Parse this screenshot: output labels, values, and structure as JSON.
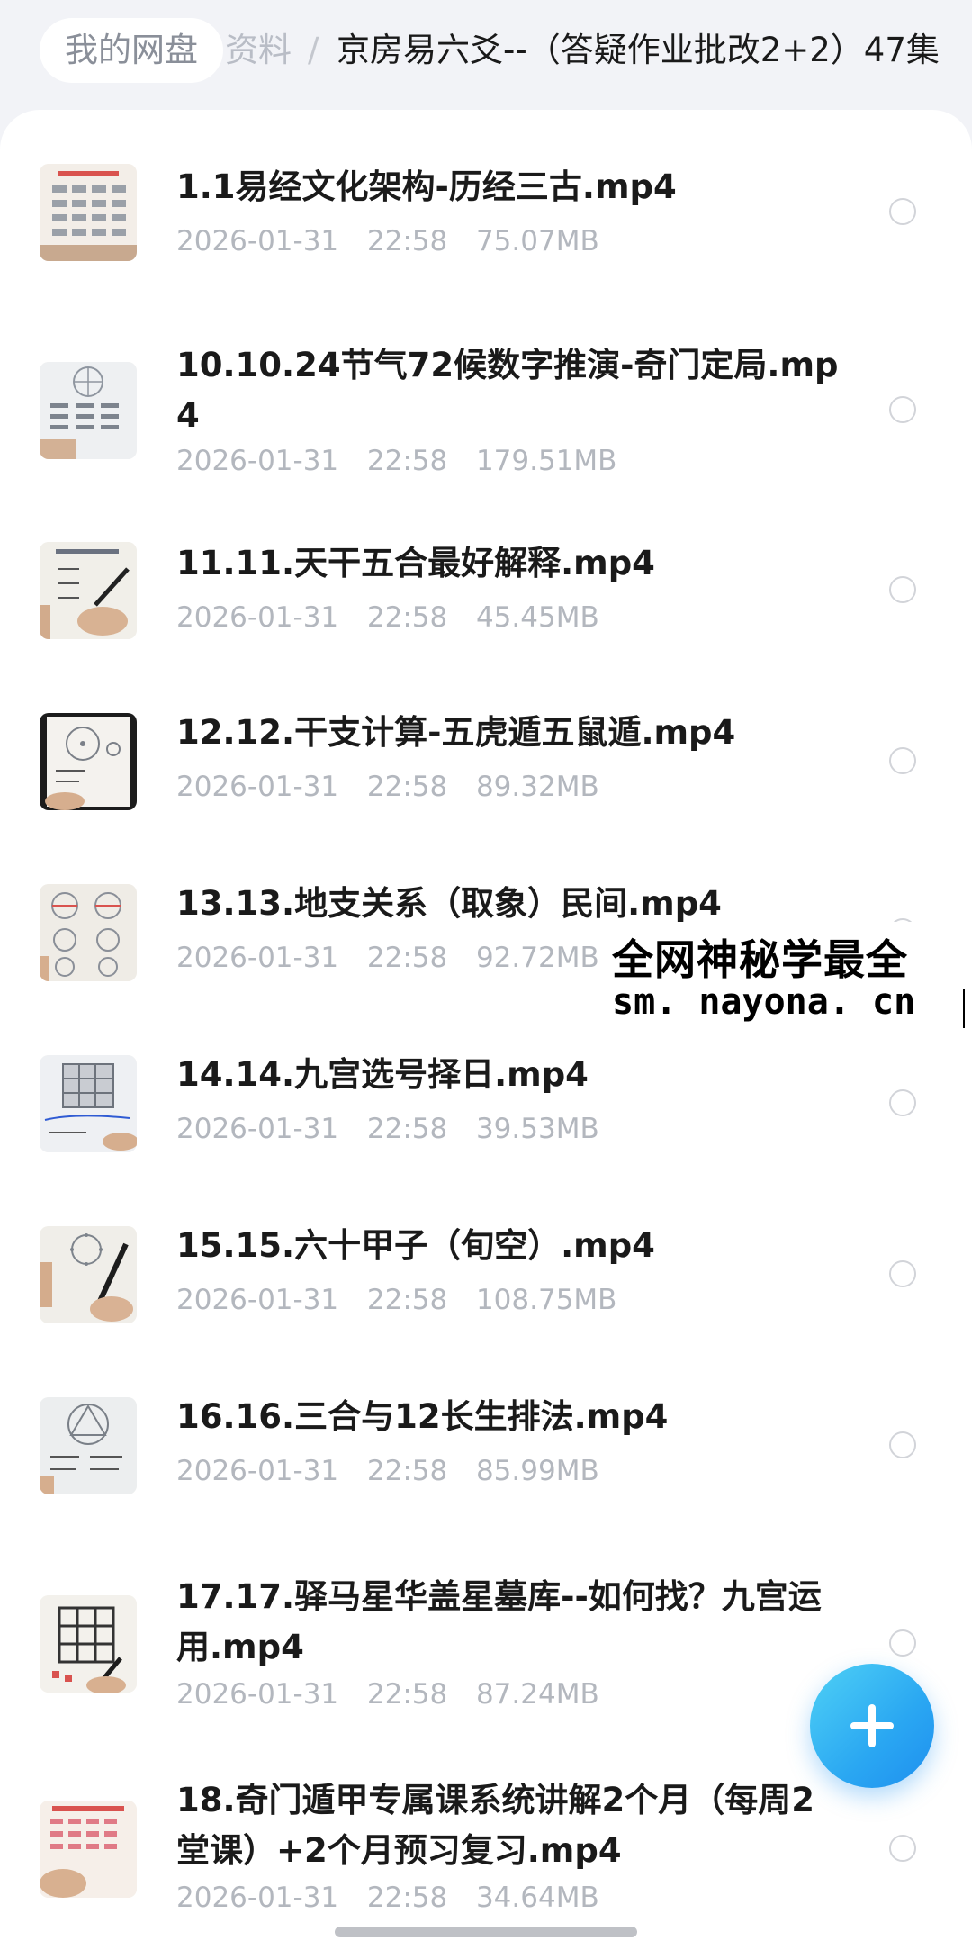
{
  "breadcrumb": {
    "root": "我的网盘",
    "middle": "资料",
    "separator": "/",
    "current": "京房易六爻--（答疑作业批改2+2）47集"
  },
  "files": [
    {
      "name": "1.1易经文化架构-历经三古.mp4",
      "date": "2026-01-31",
      "time": "22:58",
      "size": "75.07MB",
      "thumb_icon": "video-thumbnail-chart-icon"
    },
    {
      "name": "10.10.24节气72候数字推演-奇门定局.mp4",
      "date": "2026-01-31",
      "time": "22:58",
      "size": "179.51MB",
      "thumb_icon": "video-thumbnail-chart-icon"
    },
    {
      "name": "11.11.天干五合最好解释.mp4",
      "date": "2026-01-31",
      "time": "22:58",
      "size": "45.45MB",
      "thumb_icon": "video-thumbnail-handwriting-icon"
    },
    {
      "name": "12.12.干支计算-五虎遁五鼠遁.mp4",
      "date": "2026-01-31",
      "time": "22:58",
      "size": "89.32MB",
      "thumb_icon": "video-thumbnail-wheel-icon"
    },
    {
      "name": "13.13.地支关系（取象）民间.mp4",
      "date": "2026-01-31",
      "time": "22:58",
      "size": "92.72MB",
      "thumb_icon": "video-thumbnail-wheel-icon"
    },
    {
      "name": "14.14.九宫选号择日.mp4",
      "date": "2026-01-31",
      "time": "22:58",
      "size": "39.53MB",
      "thumb_icon": "video-thumbnail-grid-icon"
    },
    {
      "name": "15.15.六十甲子（旬空）.mp4",
      "date": "2026-01-31",
      "time": "22:58",
      "size": "108.75MB",
      "thumb_icon": "video-thumbnail-wheel-icon"
    },
    {
      "name": "16.16.三合与12长生排法.mp4",
      "date": "2026-01-31",
      "time": "22:58",
      "size": "85.99MB",
      "thumb_icon": "video-thumbnail-triangle-icon"
    },
    {
      "name": "17.17.驿马星华盖星墓库--如何找？九宫运用.mp4",
      "date": "2026-01-31",
      "time": "22:58",
      "size": "87.24MB",
      "thumb_icon": "video-thumbnail-grid-icon"
    },
    {
      "name": "18.奇门遁甲专属课系统讲解2个月（每周2堂课）+2个月预习复习.mp4",
      "date": "2026-01-31",
      "time": "22:58",
      "size": "34.64MB",
      "thumb_icon": "video-thumbnail-chart-icon"
    }
  ],
  "watermark": {
    "line1": "全网神秘学最全",
    "line2": "sm. nayona. cn"
  },
  "fab": {
    "icon": "plus-icon",
    "color": "#2aa7f2"
  },
  "colors": {
    "background": "#f2f3f7",
    "panel": "#ffffff",
    "text_primary": "#1a1a1a",
    "text_secondary": "#b3b7be",
    "accent": "#2aa7f2"
  }
}
